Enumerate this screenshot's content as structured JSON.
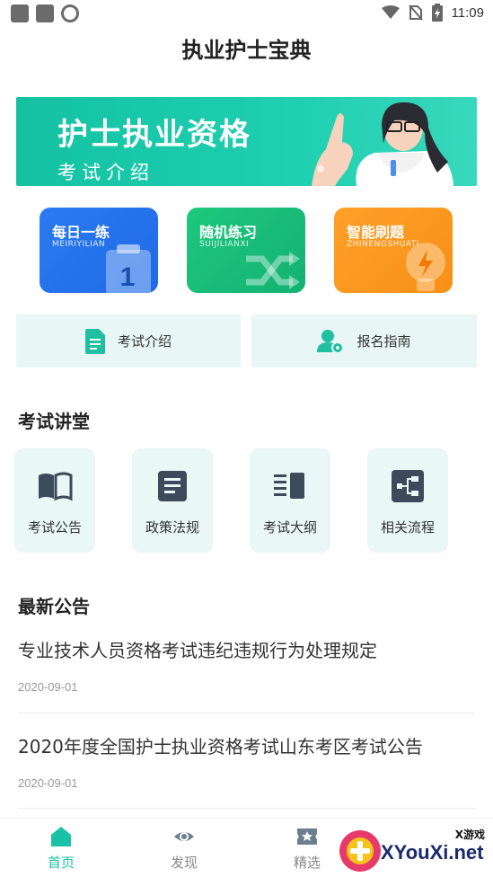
{
  "status_bar": {
    "time": "11:09"
  },
  "app": {
    "title": "执业护士宝典"
  },
  "banner": {
    "title": "护士执业资格",
    "subtitle": "考试介绍"
  },
  "practice_cards": [
    {
      "title": "每日一练",
      "subtitle": "MEIRIYILIAN",
      "color": "#2a7af0"
    },
    {
      "title": "随机练习",
      "subtitle": "SUIJILIANXI",
      "color": "#1ec77e"
    },
    {
      "title": "智能刷题",
      "subtitle": "ZHINENGSHUATI",
      "color": "#ffa028"
    }
  ],
  "card_badge": "1",
  "info_buttons": [
    {
      "label": "考试介绍",
      "icon": "document-icon"
    },
    {
      "label": "报名指南",
      "icon": "user-settings-icon"
    }
  ],
  "lecture_section": {
    "heading": "考试讲堂",
    "tiles": [
      {
        "label": "考试公告",
        "icon": "book-icon"
      },
      {
        "label": "政策法规",
        "icon": "list-doc-icon"
      },
      {
        "label": "考试大纲",
        "icon": "outline-icon"
      },
      {
        "label": "相关流程",
        "icon": "flow-icon"
      }
    ]
  },
  "news_section": {
    "heading": "最新公告",
    "items": [
      {
        "title": "专业技术人员资格考试违纪违规行为处理规定",
        "date": "2020-09-01"
      },
      {
        "title": "2020年度全国护士执业资格考试山东考区考试公告",
        "date": "2020-09-01"
      }
    ]
  },
  "bottom_nav": [
    {
      "label": "首页",
      "icon": "home-icon",
      "active": true
    },
    {
      "label": "发现",
      "icon": "eye-icon",
      "active": false
    },
    {
      "label": "精选",
      "icon": "star-ticket-icon",
      "active": false
    }
  ],
  "watermark": {
    "small": "X游戏",
    "text": "XYouXi.net"
  },
  "colors": {
    "accent": "#19c2a4",
    "tile_bg": "#e9f7f5"
  }
}
